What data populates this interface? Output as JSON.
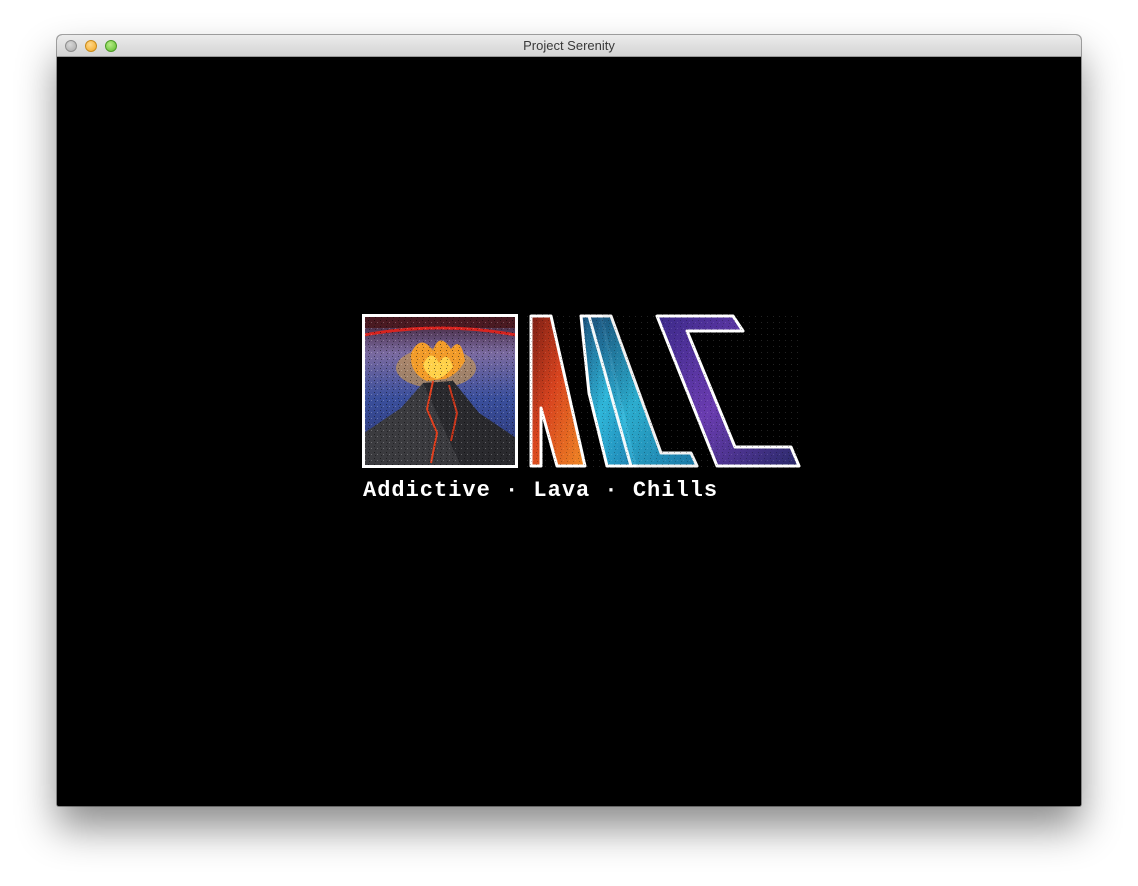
{
  "window": {
    "title": "Project Serenity",
    "controls": [
      "close",
      "minimize",
      "zoom"
    ]
  },
  "splash": {
    "logo_letters": "ALC",
    "tagline": "Addictive · Lava · Chills",
    "logo_image": "volcano-eruption-pixel-art",
    "colors": {
      "background": "#000000",
      "outline": "#ffffff",
      "lava_red": "#c8361c",
      "lava_orange": "#f08a25",
      "ice_cyan": "#2fb6d9",
      "chill_purple": "#6a3cb0"
    }
  }
}
